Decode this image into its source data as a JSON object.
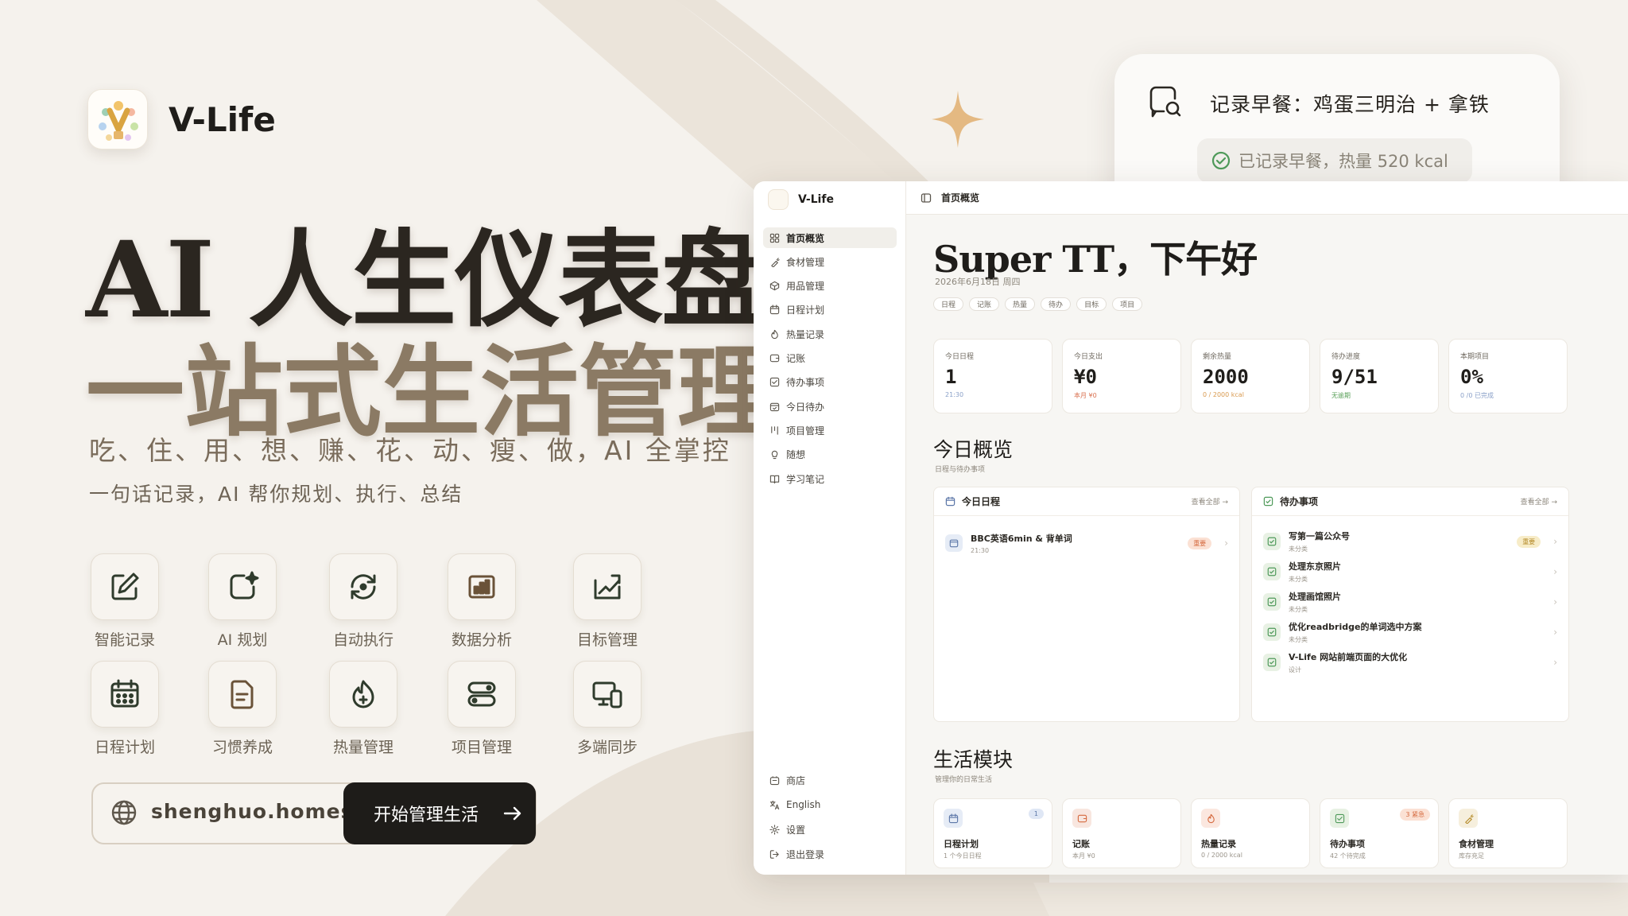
{
  "brand": {
    "name": "V-Life"
  },
  "hero": {
    "title_line1": "AI 人生仪表盘",
    "title_line2": "一站式生活管理",
    "subtitle": "吃、住、用、想、赚、花、动、瘦、做，AI 全掌控",
    "tagline": "一句话记录，AI 帮你规划、执行、总结"
  },
  "features": [
    {
      "label": "智能记录",
      "icon": "edit-icon"
    },
    {
      "label": "AI 规划",
      "icon": "ai-sparkle-icon"
    },
    {
      "label": "自动执行",
      "icon": "auto-cycle-icon"
    },
    {
      "label": "数据分析",
      "icon": "bar-chart-icon"
    },
    {
      "label": "目标管理",
      "icon": "target-chart-icon"
    },
    {
      "label": "日程计划",
      "icon": "calendar-icon"
    },
    {
      "label": "习惯养成",
      "icon": "document-icon"
    },
    {
      "label": "热量管理",
      "icon": "flame-icon"
    },
    {
      "label": "项目管理",
      "icon": "toggle-stack-icon"
    },
    {
      "label": "多端同步",
      "icon": "devices-icon"
    }
  ],
  "url": {
    "text": "shenghuo.homes",
    "icon": "globe-icon"
  },
  "cta": {
    "label": "开始管理生活"
  },
  "chat": {
    "message": "记录早餐：鸡蛋三明治 + 拿铁",
    "reply": "已记录早餐，热量 520 kcal"
  },
  "app": {
    "sidebar_brand": "V-Life",
    "nav": [
      {
        "label": "首页概览",
        "icon": "grid-icon",
        "active": true
      },
      {
        "label": "食材管理",
        "icon": "carrot-icon"
      },
      {
        "label": "用品管理",
        "icon": "box-icon"
      },
      {
        "label": "日程计划",
        "icon": "calendar-icon"
      },
      {
        "label": "热量记录",
        "icon": "flame-icon"
      },
      {
        "label": "记账",
        "icon": "wallet-icon"
      },
      {
        "label": "待办事项",
        "icon": "checkbox-icon"
      },
      {
        "label": "今日待办",
        "icon": "calendar-check-icon"
      },
      {
        "label": "项目管理",
        "icon": "kanban-icon"
      },
      {
        "label": "随想",
        "icon": "bulb-icon"
      },
      {
        "label": "学习笔记",
        "icon": "book-icon"
      }
    ],
    "nav_bottom": [
      {
        "label": "商店",
        "icon": "shop-icon"
      },
      {
        "label": "English",
        "icon": "language-icon"
      },
      {
        "label": "设置",
        "icon": "gear-icon"
      },
      {
        "label": "退出登录",
        "icon": "logout-icon"
      }
    ],
    "topbar_title": "首页概览",
    "greeting": "Super TT，下午好",
    "date": "2026年6月18日 周四",
    "tags": [
      "日程",
      "记账",
      "热量",
      "待办",
      "目标",
      "项目"
    ],
    "stats": [
      {
        "title": "今日日程",
        "value": "1",
        "note": "21:30",
        "note_color": "#8aa0c8"
      },
      {
        "title": "今日支出",
        "value": "¥0",
        "note": "本月 ¥0",
        "note_color": "#d9704f"
      },
      {
        "title": "剩余热量",
        "value": "2000",
        "note": "0 / 2000 kcal",
        "note_color": "#d99a4f"
      },
      {
        "title": "待办进度",
        "value": "9/51",
        "note": "无逾期",
        "note_color": "#5aa05a"
      },
      {
        "title": "本期项目",
        "value": "0%",
        "note": "0 /0 已完成",
        "note_color": "#8aa0c8"
      }
    ],
    "overview": {
      "title": "今日概览",
      "subtitle": "日程与待办事项"
    },
    "schedule_panel": {
      "title": "今日日程",
      "more": "查看全部 →",
      "items": [
        {
          "title": "BBC英语6min & 背单词",
          "time": "21:30",
          "badge": "重要"
        }
      ]
    },
    "todo_panel": {
      "title": "待办事项",
      "more": "查看全部 →",
      "items": [
        {
          "title": "写第一篇公众号",
          "sub": "未分类",
          "badge": "重要"
        },
        {
          "title": "处理东京照片",
          "sub": "未分类"
        },
        {
          "title": "处理画馆照片",
          "sub": "未分类"
        },
        {
          "title": "优化readbridge的单词选中方案",
          "sub": "未分类"
        },
        {
          "title": "V-Life 网站前端页面的大优化",
          "sub": "设计"
        }
      ]
    },
    "modules": {
      "title": "生活模块",
      "subtitle": "管理你的日常生活"
    },
    "module_cards": [
      {
        "title": "日程计划",
        "sub": "1 个今日日程",
        "badge": "1",
        "icon": "calendar-icon",
        "tint": "#e6ecf6",
        "badge_bg": "#dfe7f5",
        "badge_color": "#5c77a8"
      },
      {
        "title": "记账",
        "sub": "本月 ¥0",
        "badge": "",
        "icon": "wallet-icon",
        "tint": "#f8e6df"
      },
      {
        "title": "热量记录",
        "sub": "0 / 2000 kcal",
        "badge": "",
        "icon": "flame-icon",
        "tint": "#fbe7df"
      },
      {
        "title": "待办事项",
        "sub": "42 个待完成",
        "badge": "3 紧急",
        "icon": "checkbox-icon",
        "tint": "#e7f1e3",
        "badge_bg": "#fbe1d4",
        "badge_color": "#d56a3f"
      },
      {
        "title": "食材管理",
        "sub": "库存充足",
        "badge": "",
        "icon": "carrot-icon",
        "tint": "#f6efdd"
      }
    ]
  }
}
